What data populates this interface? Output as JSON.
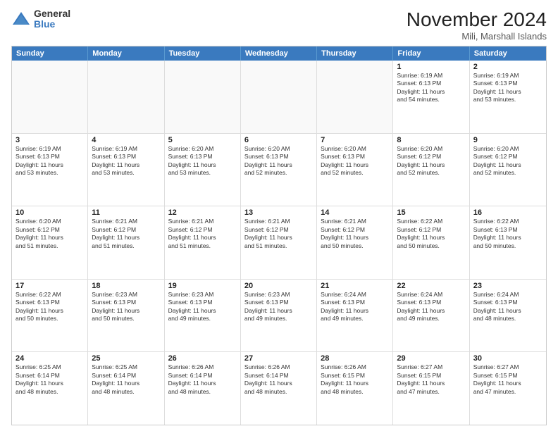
{
  "logo": {
    "general": "General",
    "blue": "Blue"
  },
  "title": "November 2024",
  "location": "Mili, Marshall Islands",
  "header_days": [
    "Sunday",
    "Monday",
    "Tuesday",
    "Wednesday",
    "Thursday",
    "Friday",
    "Saturday"
  ],
  "rows": [
    [
      {
        "day": "",
        "info": "",
        "empty": true
      },
      {
        "day": "",
        "info": "",
        "empty": true
      },
      {
        "day": "",
        "info": "",
        "empty": true
      },
      {
        "day": "",
        "info": "",
        "empty": true
      },
      {
        "day": "",
        "info": "",
        "empty": true
      },
      {
        "day": "1",
        "info": "Sunrise: 6:19 AM\nSunset: 6:13 PM\nDaylight: 11 hours\nand 54 minutes.",
        "empty": false
      },
      {
        "day": "2",
        "info": "Sunrise: 6:19 AM\nSunset: 6:13 PM\nDaylight: 11 hours\nand 53 minutes.",
        "empty": false
      }
    ],
    [
      {
        "day": "3",
        "info": "Sunrise: 6:19 AM\nSunset: 6:13 PM\nDaylight: 11 hours\nand 53 minutes.",
        "empty": false
      },
      {
        "day": "4",
        "info": "Sunrise: 6:19 AM\nSunset: 6:13 PM\nDaylight: 11 hours\nand 53 minutes.",
        "empty": false
      },
      {
        "day": "5",
        "info": "Sunrise: 6:20 AM\nSunset: 6:13 PM\nDaylight: 11 hours\nand 53 minutes.",
        "empty": false
      },
      {
        "day": "6",
        "info": "Sunrise: 6:20 AM\nSunset: 6:13 PM\nDaylight: 11 hours\nand 52 minutes.",
        "empty": false
      },
      {
        "day": "7",
        "info": "Sunrise: 6:20 AM\nSunset: 6:13 PM\nDaylight: 11 hours\nand 52 minutes.",
        "empty": false
      },
      {
        "day": "8",
        "info": "Sunrise: 6:20 AM\nSunset: 6:12 PM\nDaylight: 11 hours\nand 52 minutes.",
        "empty": false
      },
      {
        "day": "9",
        "info": "Sunrise: 6:20 AM\nSunset: 6:12 PM\nDaylight: 11 hours\nand 52 minutes.",
        "empty": false
      }
    ],
    [
      {
        "day": "10",
        "info": "Sunrise: 6:20 AM\nSunset: 6:12 PM\nDaylight: 11 hours\nand 51 minutes.",
        "empty": false
      },
      {
        "day": "11",
        "info": "Sunrise: 6:21 AM\nSunset: 6:12 PM\nDaylight: 11 hours\nand 51 minutes.",
        "empty": false
      },
      {
        "day": "12",
        "info": "Sunrise: 6:21 AM\nSunset: 6:12 PM\nDaylight: 11 hours\nand 51 minutes.",
        "empty": false
      },
      {
        "day": "13",
        "info": "Sunrise: 6:21 AM\nSunset: 6:12 PM\nDaylight: 11 hours\nand 51 minutes.",
        "empty": false
      },
      {
        "day": "14",
        "info": "Sunrise: 6:21 AM\nSunset: 6:12 PM\nDaylight: 11 hours\nand 50 minutes.",
        "empty": false
      },
      {
        "day": "15",
        "info": "Sunrise: 6:22 AM\nSunset: 6:12 PM\nDaylight: 11 hours\nand 50 minutes.",
        "empty": false
      },
      {
        "day": "16",
        "info": "Sunrise: 6:22 AM\nSunset: 6:13 PM\nDaylight: 11 hours\nand 50 minutes.",
        "empty": false
      }
    ],
    [
      {
        "day": "17",
        "info": "Sunrise: 6:22 AM\nSunset: 6:13 PM\nDaylight: 11 hours\nand 50 minutes.",
        "empty": false
      },
      {
        "day": "18",
        "info": "Sunrise: 6:23 AM\nSunset: 6:13 PM\nDaylight: 11 hours\nand 50 minutes.",
        "empty": false
      },
      {
        "day": "19",
        "info": "Sunrise: 6:23 AM\nSunset: 6:13 PM\nDaylight: 11 hours\nand 49 minutes.",
        "empty": false
      },
      {
        "day": "20",
        "info": "Sunrise: 6:23 AM\nSunset: 6:13 PM\nDaylight: 11 hours\nand 49 minutes.",
        "empty": false
      },
      {
        "day": "21",
        "info": "Sunrise: 6:24 AM\nSunset: 6:13 PM\nDaylight: 11 hours\nand 49 minutes.",
        "empty": false
      },
      {
        "day": "22",
        "info": "Sunrise: 6:24 AM\nSunset: 6:13 PM\nDaylight: 11 hours\nand 49 minutes.",
        "empty": false
      },
      {
        "day": "23",
        "info": "Sunrise: 6:24 AM\nSunset: 6:13 PM\nDaylight: 11 hours\nand 48 minutes.",
        "empty": false
      }
    ],
    [
      {
        "day": "24",
        "info": "Sunrise: 6:25 AM\nSunset: 6:14 PM\nDaylight: 11 hours\nand 48 minutes.",
        "empty": false
      },
      {
        "day": "25",
        "info": "Sunrise: 6:25 AM\nSunset: 6:14 PM\nDaylight: 11 hours\nand 48 minutes.",
        "empty": false
      },
      {
        "day": "26",
        "info": "Sunrise: 6:26 AM\nSunset: 6:14 PM\nDaylight: 11 hours\nand 48 minutes.",
        "empty": false
      },
      {
        "day": "27",
        "info": "Sunrise: 6:26 AM\nSunset: 6:14 PM\nDaylight: 11 hours\nand 48 minutes.",
        "empty": false
      },
      {
        "day": "28",
        "info": "Sunrise: 6:26 AM\nSunset: 6:15 PM\nDaylight: 11 hours\nand 48 minutes.",
        "empty": false
      },
      {
        "day": "29",
        "info": "Sunrise: 6:27 AM\nSunset: 6:15 PM\nDaylight: 11 hours\nand 47 minutes.",
        "empty": false
      },
      {
        "day": "30",
        "info": "Sunrise: 6:27 AM\nSunset: 6:15 PM\nDaylight: 11 hours\nand 47 minutes.",
        "empty": false
      }
    ]
  ]
}
